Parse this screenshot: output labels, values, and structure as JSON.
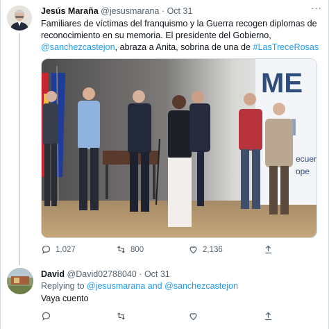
{
  "tweet": {
    "author_name": "Jesús Maraña",
    "author_handle": "@jesusmarana",
    "separator": "·",
    "date": "Oct 31",
    "more": "···",
    "text_part1": "Familiares de víctimas del franquismo y la Guerra recogen diplomas de reconocimiento en su memoria. El presidente del Gobierno, ",
    "mention": "@sanchezcastejon",
    "text_part2": ", abraza a Anita, sobrina de una de ",
    "hashtag": "#LasTreceRosas",
    "photo_banner_text": "ME",
    "photo_banner_text2": "M",
    "photo_side_text1": "ecuer",
    "photo_side_text2": "ope",
    "actions": {
      "reply_count": "1,027",
      "retweet_count": "800",
      "like_count": "2,136",
      "reply_icon": "reply-icon",
      "retweet_icon": "retweet-icon",
      "like_icon": "heart-icon",
      "share_icon": "share-icon"
    }
  },
  "reply": {
    "author_name": "David",
    "author_handle": "@David02788040",
    "separator": "·",
    "date": "Oct 31",
    "replying_prefix": "Replying to ",
    "replying_to_1": "@jesusmarana",
    "replying_and": " and ",
    "replying_to_2": "@sanchezcastejon",
    "text": "Vaya cuento"
  },
  "colors": {
    "link": "#1d9bf0",
    "muted": "#536471",
    "border": "#cfd9de"
  }
}
